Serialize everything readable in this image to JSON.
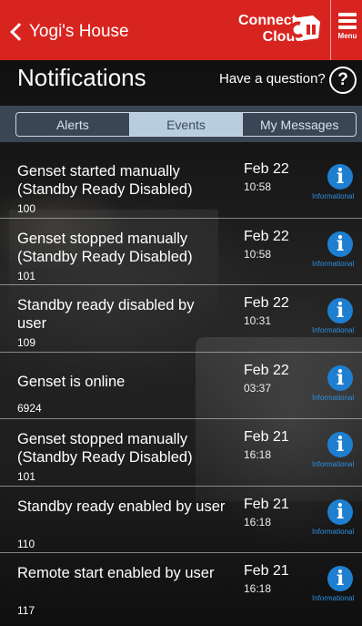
{
  "header": {
    "back_label": "Yogi's House",
    "brand_line1": "Connect",
    "brand_line2": "Cloud",
    "menu_label": "Menu",
    "color": "#d8241f"
  },
  "page": {
    "title": "Notifications",
    "question_label": "Have a question?",
    "question_icon": "?"
  },
  "tabs": [
    {
      "label": "Alerts",
      "active": false
    },
    {
      "label": "Events",
      "active": true
    },
    {
      "label": "My Messages",
      "active": false
    }
  ],
  "events": [
    {
      "message": "Genset started manually (Standby Ready Disabled)",
      "code": "100",
      "date": "Feb 22",
      "time": "10:58",
      "level": "Informational"
    },
    {
      "message": "Genset stopped manually (Standby Ready Disabled)",
      "code": "101",
      "date": "Feb 22",
      "time": "10:58",
      "level": "Informational"
    },
    {
      "message": "Standby ready disabled by user",
      "code": "109",
      "date": "Feb 22",
      "time": "10:31",
      "level": "Informational"
    },
    {
      "message": "Genset is online",
      "code": "6924",
      "date": "Feb 22",
      "time": "03:37",
      "level": "Informational"
    },
    {
      "message": "Genset stopped manually (Standby Ready Disabled)",
      "code": "101",
      "date": "Feb 21",
      "time": "16:18",
      "level": "Informational"
    },
    {
      "message": "Standby ready enabled by user",
      "code": "110",
      "date": "Feb 21",
      "time": "16:18",
      "level": "Informational"
    },
    {
      "message": "Remote start enabled by user",
      "code": "117",
      "date": "Feb 21",
      "time": "16:18",
      "level": "Informational"
    }
  ],
  "icons": {
    "back": "chevron-left-icon",
    "logo": "cummins-logo-icon",
    "menu": "hamburger-menu-icon",
    "help": "question-circle-icon",
    "info": "info-icon"
  },
  "colors": {
    "info_blue": "#1e7fd0",
    "segment_active": "#b9cde0"
  }
}
